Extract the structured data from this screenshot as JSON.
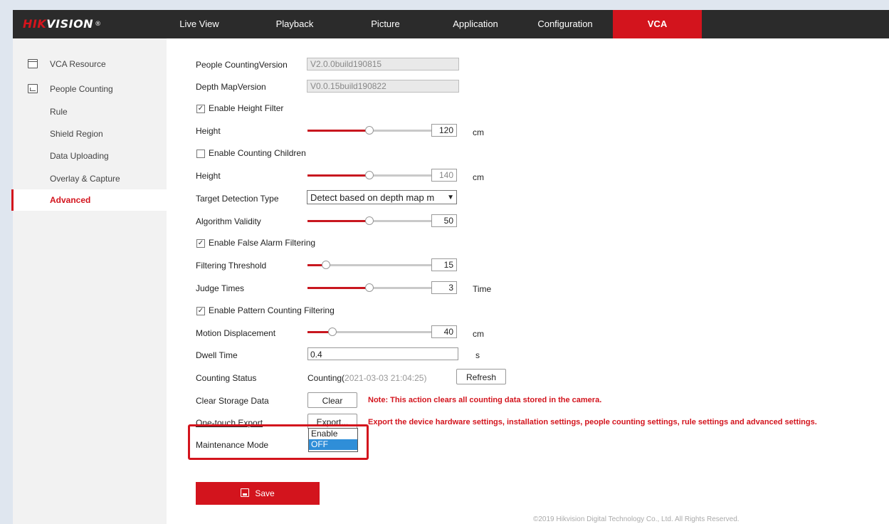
{
  "brand": {
    "logo_red": "HIK",
    "logo_white": "VISION",
    "logo_reg": "®"
  },
  "nav": {
    "items": [
      "Live View",
      "Playback",
      "Picture",
      "Application",
      "Configuration",
      "VCA"
    ],
    "active": "VCA"
  },
  "sidebar": {
    "vca_resource": "VCA Resource",
    "people_counting": "People Counting",
    "items": [
      "Rule",
      "Shield Region",
      "Data Uploading",
      "Overlay & Capture",
      "Advanced"
    ],
    "active": "Advanced"
  },
  "form": {
    "people_counting_version_label": "People CountingVersion",
    "people_counting_version": "V2.0.0build190815",
    "depth_map_version_label": "Depth MapVersion",
    "depth_map_version": "V0.0.15build190822",
    "enable_height_filter": {
      "label": "Enable Height Filter",
      "checked": true
    },
    "height1": {
      "label": "Height",
      "value": "120",
      "unit": "cm",
      "level": 0.5
    },
    "enable_counting_children": {
      "label": "Enable Counting Children",
      "checked": false
    },
    "height2": {
      "label": "Height",
      "value": "140",
      "unit": "cm",
      "level": 0.5
    },
    "target_detection_type": {
      "label": "Target Detection Type",
      "value": "Detect based on depth map m"
    },
    "algorithm_validity": {
      "label": "Algorithm Validity",
      "value": "50",
      "level": 0.5
    },
    "enable_false_alarm_filtering": {
      "label": "Enable False Alarm Filtering",
      "checked": true
    },
    "filtering_threshold": {
      "label": "Filtering Threshold",
      "value": "15",
      "level": 0.15
    },
    "judge_times": {
      "label": "Judge Times",
      "value": "3",
      "unit": "Time",
      "level": 0.5
    },
    "enable_pattern_counting_filtering": {
      "label": "Enable Pattern Counting Filtering",
      "checked": true
    },
    "motion_displacement": {
      "label": "Motion Displacement",
      "value": "40",
      "unit": "cm",
      "level": 0.2
    },
    "dwell_time": {
      "label": "Dwell Time",
      "value": "0.4",
      "unit": "s"
    },
    "counting_status": {
      "label": "Counting Status",
      "status": "Counting(",
      "time": "2021-03-03 21:04:25)",
      "refresh": "Refresh"
    },
    "clear_storage": {
      "label": "Clear Storage Data",
      "button": "Clear",
      "note": "Note: This action clears all counting data stored in the camera."
    },
    "one_touch_export": {
      "label": "One-touch Export",
      "button": "Export...",
      "note": "Export the device hardware settings, installation settings, people counting settings, rule settings and advanced settings."
    },
    "maintenance_mode": {
      "label": "Maintenance Mode",
      "options": [
        "Enable",
        "OFF"
      ],
      "selected": "OFF"
    }
  },
  "save_label": "Save",
  "copyright": "©2019 Hikvision Digital Technology Co., Ltd. All Rights Reserved.",
  "colors": {
    "accent": "#d3141d",
    "topbar": "#2b2b2b",
    "dropdown_selected": "#2f8ed8"
  }
}
